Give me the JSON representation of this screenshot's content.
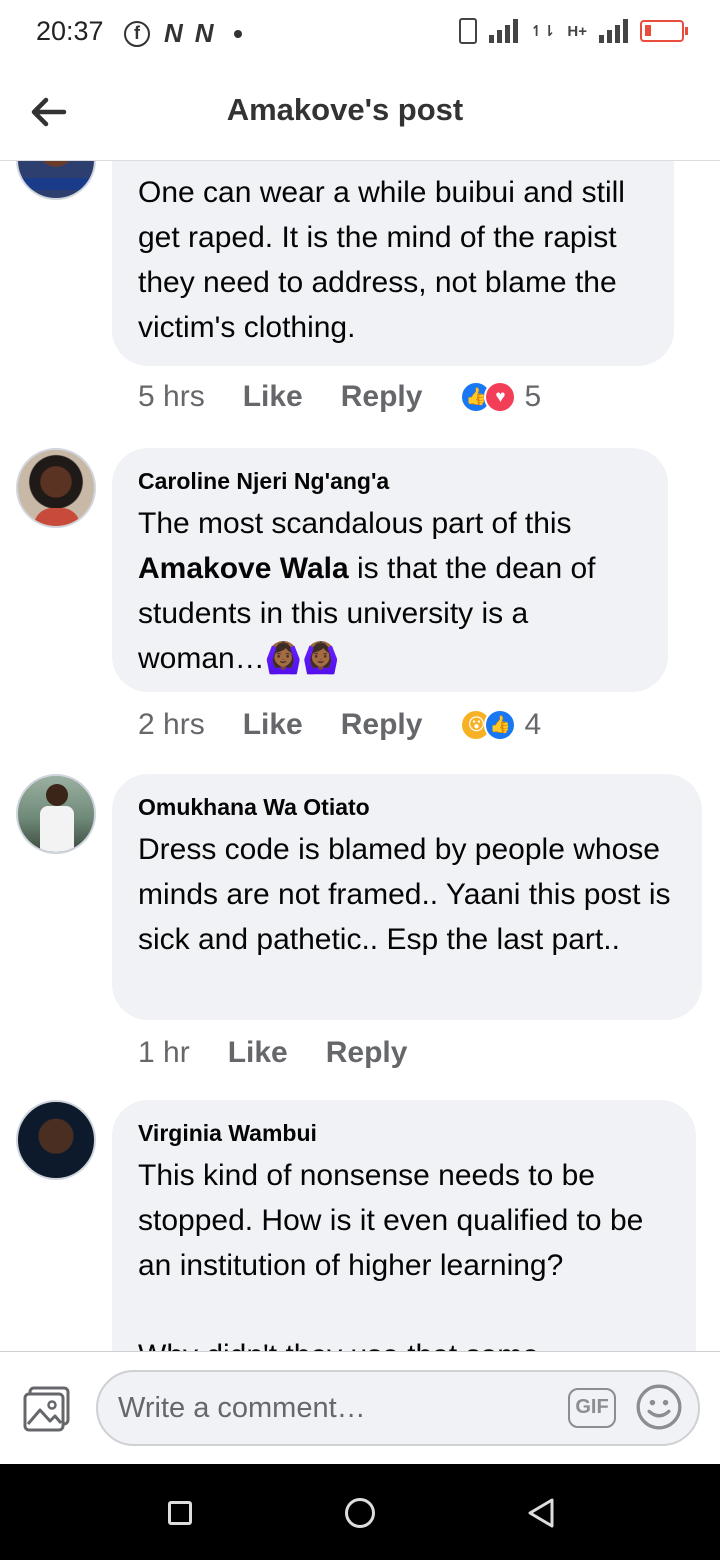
{
  "status_bar": {
    "time": "20:37",
    "left_icons": [
      "facebook-icon",
      "n-app-icon",
      "n-app-icon",
      "dot-icon"
    ],
    "network": "H+",
    "battery_color": "#e94b3c"
  },
  "header": {
    "title": "Amakove's post"
  },
  "comments": [
    {
      "author": "",
      "text": "One can wear a while buibui and still get raped. It is the mind of the rapist they need to address, not blame the victim's clothing.",
      "time": "5 hrs",
      "like_label": "Like",
      "reply_label": "Reply",
      "reactions": [
        "like",
        "love"
      ],
      "reaction_count": "5"
    },
    {
      "author": "Caroline Njeri Ng'ang'a",
      "text_before": "The most scandalous part of this ",
      "mention": "Amakove Wala",
      "text_after": " is that the dean of students in this university is a woman…🙆🏾‍♀️🙆🏾‍♀️",
      "time": "2 hrs",
      "like_label": "Like",
      "reply_label": "Reply",
      "reactions": [
        "wow",
        "like"
      ],
      "reaction_count": "4"
    },
    {
      "author": "Omukhana Wa Otiato",
      "text": "Dress code is blamed by people whose minds are not framed.. Yaani this post is sick and pathetic.. Esp the last part..",
      "time": "1 hr",
      "like_label": "Like",
      "reply_label": "Reply"
    },
    {
      "author": "Virginia Wambui",
      "text": "This kind of nonsense needs to be stopped. How is it even qualified to be an institution of higher learning?",
      "text_cut": "Why didn't they use that same"
    }
  ],
  "composer": {
    "placeholder": "Write a comment…",
    "gif_label": "GIF"
  },
  "colors": {
    "bubble": "#f0f2f5",
    "secondary_text": "#65676b",
    "like_blue": "#1877f2",
    "love_red": "#f33e58"
  }
}
